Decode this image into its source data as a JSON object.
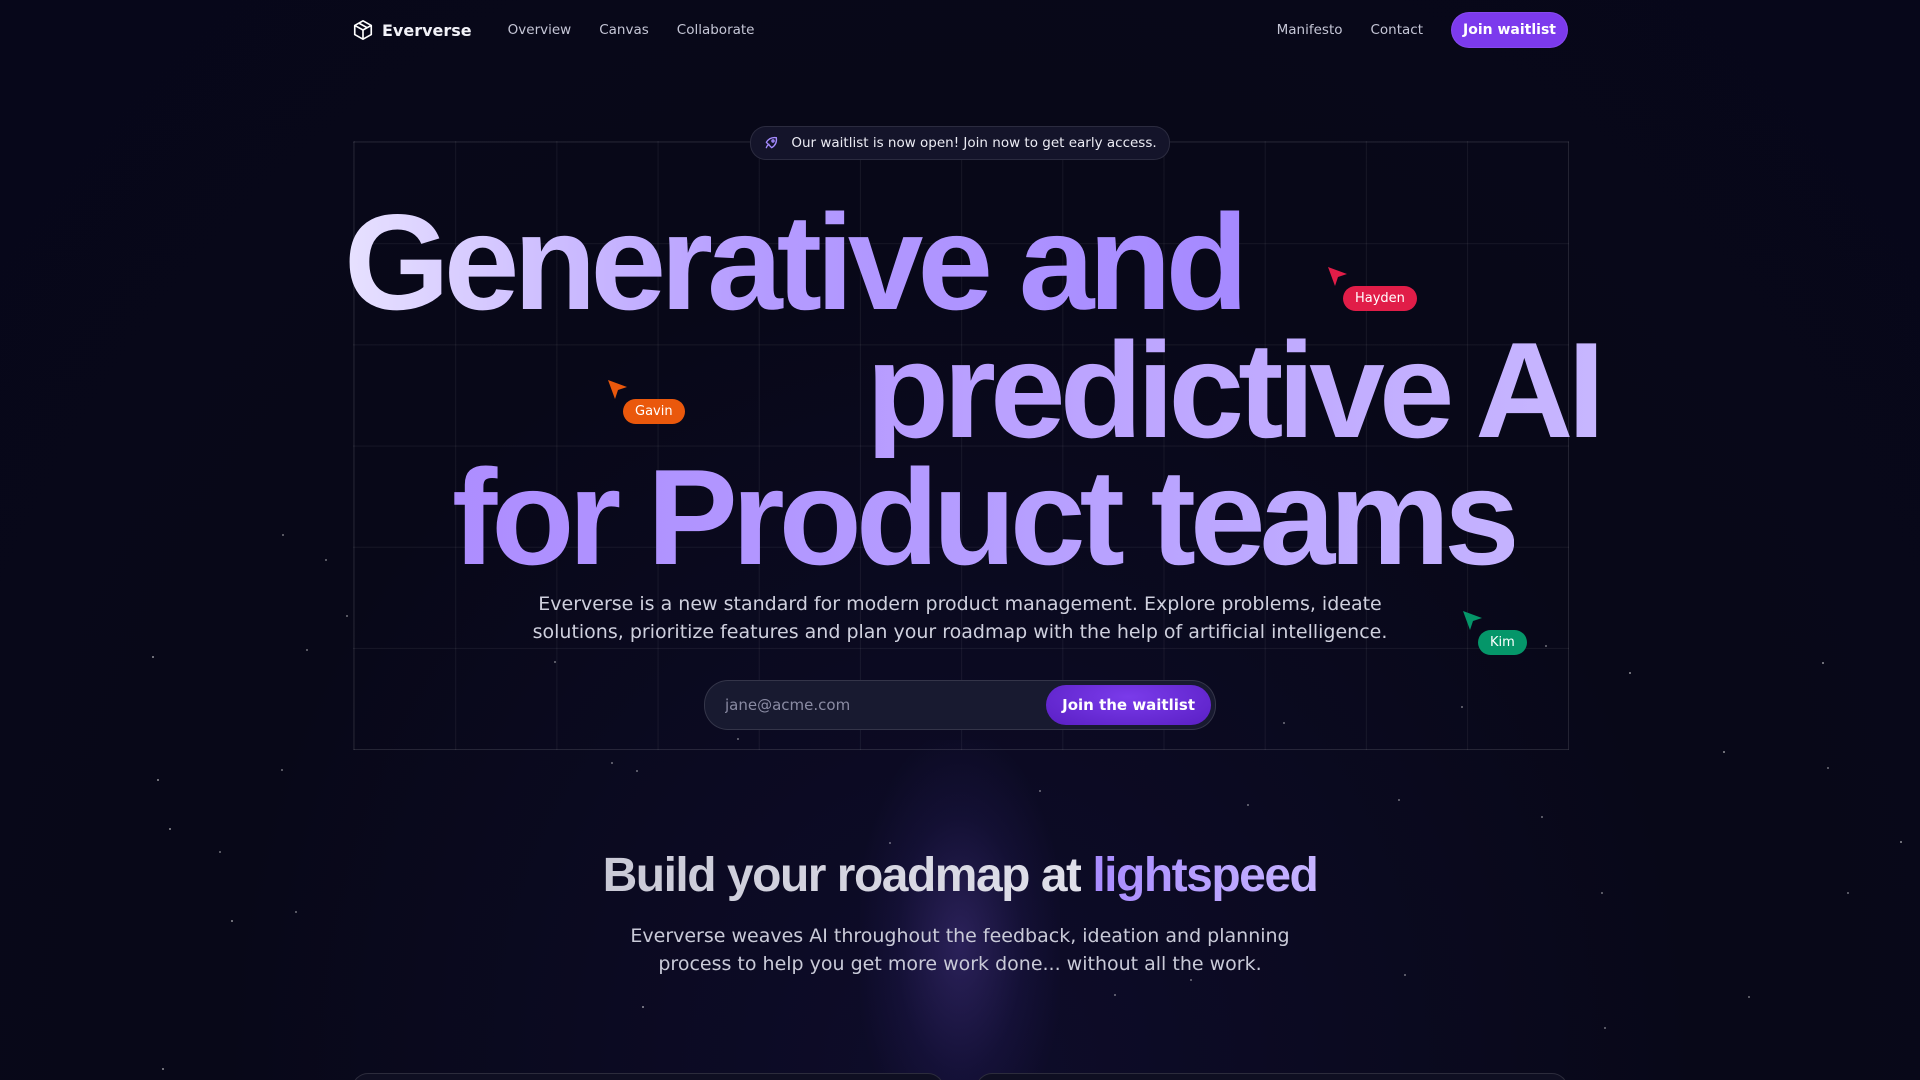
{
  "nav": {
    "brand": "Eververse",
    "links": [
      "Overview",
      "Canvas",
      "Collaborate"
    ],
    "right_links": [
      "Manifesto",
      "Contact"
    ],
    "cta": "Join waitlist"
  },
  "hero": {
    "announcement": "Our waitlist is now open! Join now to get early access.",
    "headline": [
      "Generative and",
      "predictive AI",
      "for Product teams"
    ],
    "subcopy": "Eververse is a new standard for modern product management. Explore problems, ideate solutions, prioritize features and plan your roadmap with the help of artificial intelligence.",
    "email_placeholder": "jane@acme.com",
    "submit_label": "Join the waitlist"
  },
  "cursors": [
    {
      "name": "Hayden",
      "color": "#e11d48"
    },
    {
      "name": "Gavin",
      "color": "#ea580c"
    },
    {
      "name": "Kim",
      "color": "#059669"
    }
  ],
  "section": {
    "title_plain": "Build your roadmap at",
    "title_accent": "lightspeed",
    "subcopy": "Eververse weaves AI throughout the feedback, ideation and planning process to help you get more work done... without all the work."
  },
  "colors": {
    "accent": "#7c3aed",
    "background": "#080818"
  }
}
